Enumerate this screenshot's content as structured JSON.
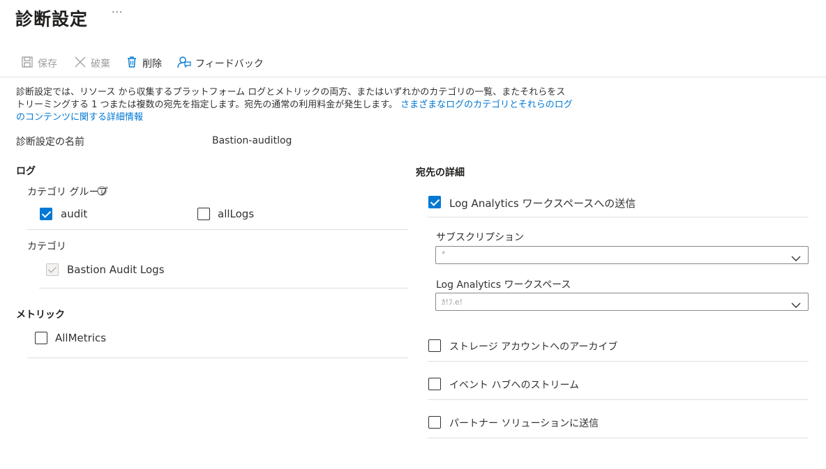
{
  "header": {
    "title": "診断設定",
    "more": "···"
  },
  "toolbar": {
    "save_label": "保存",
    "discard_label": "破棄",
    "delete_label": "削除",
    "feedback_label": "フィードバック"
  },
  "description": {
    "text": "診断設定では、リソース から収集するプラットフォーム ログとメトリックの両方、またはいずれかのカテゴリの一覧、またそれらをストリーミングする 1 つまたは複数の宛先を指定します。宛先の通常の利用料金が発生します。",
    "link": "さまざまなログのカテゴリとそれらのログのコンテンツに関する詳細情報"
  },
  "name_field": {
    "label": "診断設定の名前",
    "value": "Bastion-auditlog"
  },
  "logs": {
    "heading": "ログ",
    "category_group_label": "カテゴリ グループ",
    "audit": {
      "label": "audit",
      "checked": true
    },
    "alllogs": {
      "label": "allLogs",
      "checked": false
    },
    "category_label": "カテゴリ",
    "bastion_audit": {
      "label": "Bastion Audit Logs",
      "checked": true,
      "disabled": true
    }
  },
  "metrics": {
    "heading": "メトリック",
    "allmetrics": {
      "label": "AllMetrics",
      "checked": false
    }
  },
  "destination": {
    "heading": "宛先の詳細",
    "log_analytics": {
      "label": "Log Analytics ワークスペースへの送信",
      "checked": true
    },
    "subscription_label": "サブスクリプション",
    "subscription_value": "*",
    "workspace_label": "Log Analytics ワークスペース",
    "workspace_value": "ｶ!ﾌ.e!",
    "storage": {
      "label": "ストレージ アカウントへのアーカイブ",
      "checked": false
    },
    "eventhub": {
      "label": "イベント ハブへのストリーム",
      "checked": false
    },
    "partner": {
      "label": "パートナー ソリューションに送信",
      "checked": false
    }
  },
  "colors": {
    "accent": "#0078d4",
    "disabled": "#a19f9d",
    "divider": "#e1dfdd"
  }
}
